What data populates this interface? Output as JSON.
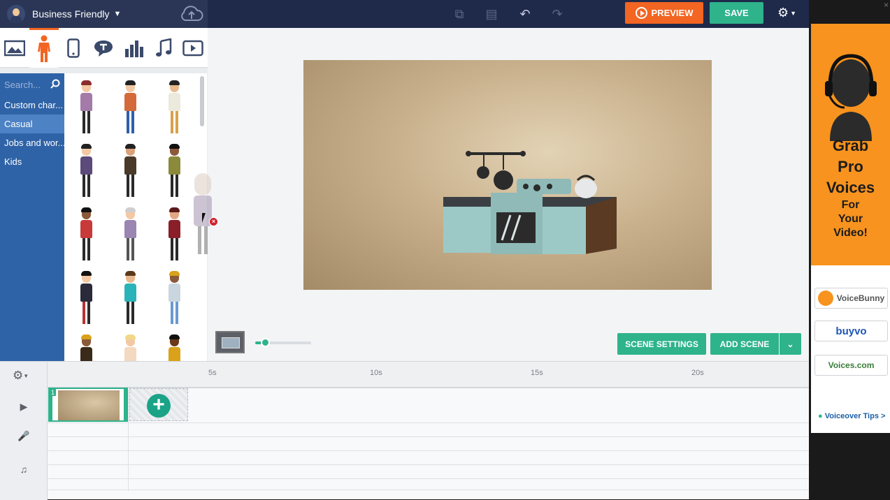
{
  "app": {
    "workspace_name": "Business Friendly",
    "buttons": {
      "preview": "PREVIEW",
      "save": "SAVE",
      "scene_settings": "SCENE SETTINGS",
      "add_scene": "ADD SCENE"
    }
  },
  "colors": {
    "accent_orange": "#f26522",
    "accent_green": "#2eb38b",
    "nav_dark": "#1f2a4a",
    "sidebar_blue": "#2f63a7"
  },
  "asset_tabs": [
    {
      "icon": "image-icon"
    },
    {
      "icon": "character-icon",
      "active": true
    },
    {
      "icon": "device-icon"
    },
    {
      "icon": "speech-bubble-icon"
    },
    {
      "icon": "chart-icon"
    },
    {
      "icon": "music-note-icon"
    },
    {
      "icon": "video-icon"
    }
  ],
  "sidebar": {
    "search_placeholder": "Search...",
    "categories": [
      "Custom char...",
      "Casual",
      "Jobs and wor...",
      "Kids"
    ],
    "selected_category": "Casual"
  },
  "timeline": {
    "ticks": [
      "5s",
      "10s",
      "15s",
      "20s"
    ],
    "scene_number": "1",
    "track_icons": [
      "camera-icon",
      "microphone-icon",
      "music-note-icon"
    ]
  },
  "ad": {
    "headline": [
      "Grab",
      "Pro",
      "Voices"
    ],
    "subline": [
      "For",
      "Your",
      "Video!"
    ],
    "logos": [
      "VoiceBunny",
      "buyvo",
      "Voices.com"
    ],
    "tips": "Voiceover Tips >"
  }
}
